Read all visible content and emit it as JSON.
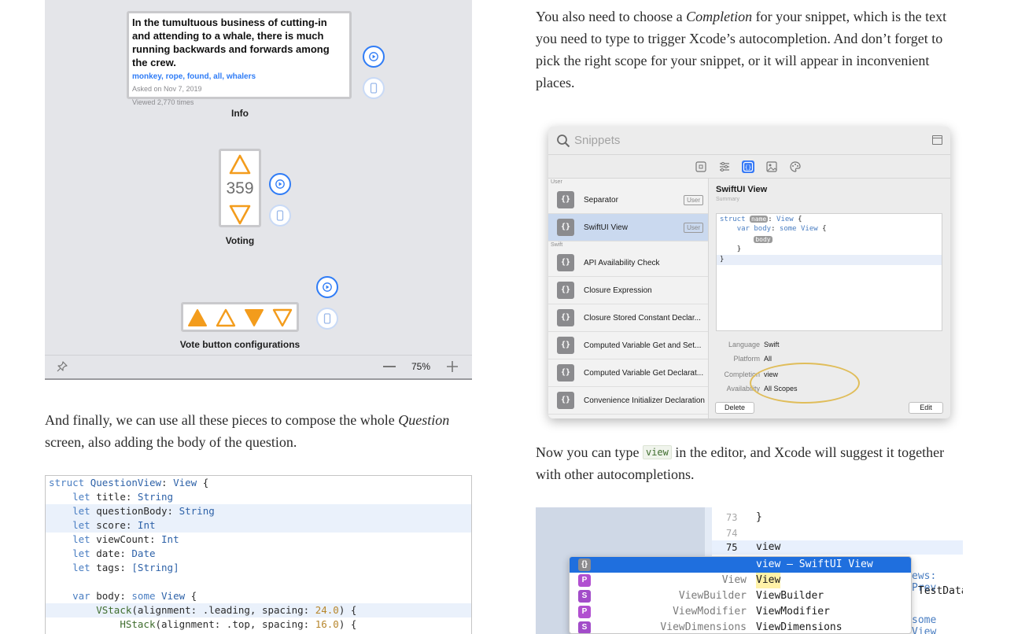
{
  "preview": {
    "card": {
      "title": "In the tumultuous business of cutting-in and attending to a whale, there is much running backwards and forwards among the crew.",
      "tags": "monkey, rope, found, all, whalers",
      "asked": "Asked on Nov 7, 2019",
      "viewed": "Viewed 2,770 times"
    },
    "info_caption": "Info",
    "score": "359",
    "voting_caption": "Voting",
    "configs_caption": "Vote button configurations",
    "zoom_level": "75%",
    "colors": {
      "accent": "#2f7cf6",
      "vote": "#f39c1c",
      "canvas": "#e4e5e9"
    },
    "icons": [
      "play-icon",
      "device-icon",
      "pin-icon",
      "zoom-out-icon",
      "zoom-in-icon",
      "arrow-up-icon",
      "arrow-down-icon"
    ]
  },
  "text": {
    "completion_part1": "You also need to choose a ",
    "completion_em": "Completion",
    "completion_part2": " for your snippet, which is the text you need to type to trigger Xcode’s autocompletion. And don’t forget to pick the right scope for your snippet, or it will appear in inconvenient places.",
    "finally_part1": "And finally, we can use all these pieces to compose the whole ",
    "finally_em": "Question",
    "finally_part2": " screen, also adding the body of the question.",
    "now_part1": "Now you can type ",
    "now_code": "view",
    "now_part2": " in the editor, and Xcode will suggest it together with other autocompletions."
  },
  "snippets": {
    "search_placeholder": "Snippets",
    "group_user": "User",
    "group_swift": "Swift",
    "user_items": [
      {
        "label": "Separator",
        "badge": "User"
      },
      {
        "label": "SwiftUI View",
        "badge": "User"
      }
    ],
    "swift_items": [
      "API Availability Check",
      "Closure Expression",
      "Closure Stored Constant Declar...",
      "Computed Variable Get and Set...",
      "Computed Variable Get Declarat...",
      "Convenience Initializer Declaration"
    ],
    "icon_glyph": "{}",
    "detail": {
      "title": "SwiftUI View",
      "summary": "Summary",
      "code_kw_struct": "struct",
      "code_token_name": "name",
      "code_type_view": "View",
      "code_kw_var": "var",
      "code_prop_body": "body",
      "code_kw_some": "some",
      "code_token_body": "body",
      "code_open": "{",
      "code_close": "}",
      "language_label": "Language",
      "language_value": "Swift",
      "platform_label": "Platform",
      "platform_value": "All",
      "completion_label": "Completion",
      "completion_value": "view",
      "availability_label": "Availability",
      "availability_value": "All Scopes",
      "delete_button": "Delete",
      "edit_button": "Edit"
    }
  },
  "codeblock": {
    "struct_kw": "struct",
    "struct_name": "QuestionView",
    "struct_proto": "View",
    "props": [
      {
        "name": "title",
        "type": "String"
      },
      {
        "name": "questionBody",
        "type": "String"
      },
      {
        "name": "score",
        "type": "Int"
      },
      {
        "name": "viewCount",
        "type": "Int"
      },
      {
        "name": "date",
        "type": "Date"
      },
      {
        "name": "tags",
        "type": "[String]"
      }
    ],
    "let_kw": "let",
    "var_kw": "var",
    "body_name": "body",
    "some_kw": "some",
    "vstack": "VStack",
    "vstack_align_label": "alignment",
    "vstack_align": ".leading",
    "spacing_label": "spacing",
    "vstack_spacing": "24.0",
    "hstack": "HStack",
    "hstack_align": ".top",
    "hstack_spacing": "16.0"
  },
  "autocomplete": {
    "line_numbers": [
      "73",
      "74",
      "75"
    ],
    "line73": "}",
    "line75": "view",
    "items": [
      {
        "icon": "{}",
        "icon_color": "#8b8b8e",
        "type": "",
        "name": "view – SwiftUI View"
      },
      {
        "icon": "P",
        "icon_color": "#b14fd0",
        "type": "View",
        "name": "View"
      },
      {
        "icon": "S",
        "icon_color": "#a24cc9",
        "type": "ViewBuilder",
        "name": "ViewBuilder"
      },
      {
        "icon": "P",
        "icon_color": "#b14fd0",
        "type": "ViewModifier",
        "name": "ViewModifier"
      },
      {
        "icon": "S",
        "icon_color": "#a24cc9",
        "type": "ViewDimensions",
        "name": "ViewDimensions"
      }
    ],
    "peek_1": "ews: Prev",
    "peek_2": "TestData",
    "peek_3": "some View"
  }
}
